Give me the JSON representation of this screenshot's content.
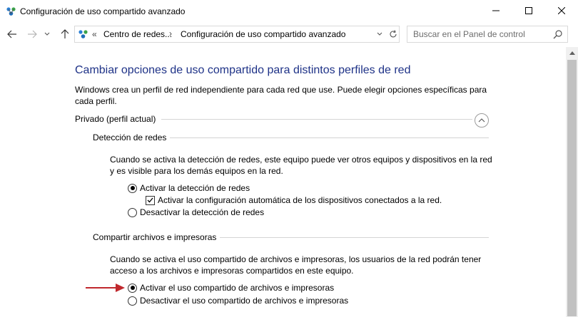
{
  "window": {
    "title": "Configuración de uso compartido avanzado",
    "minimize_glyph": "—",
    "maximize_glyph": "☐",
    "close_glyph": "✕"
  },
  "nav": {
    "back_icon": "arrow-left-icon",
    "forward_icon": "arrow-right-icon",
    "recent_icon": "chevron-down-icon",
    "up_icon": "arrow-up-icon"
  },
  "address": {
    "overflow": "«",
    "crumb1": "Centro de redes...",
    "separator": "›",
    "crumb2": "Configuración de uso compartido avanzado"
  },
  "search": {
    "placeholder": "Buscar en el Panel de control"
  },
  "content": {
    "heading": "Cambiar opciones de uso compartido para distintos perfiles de red",
    "description": "Windows crea un perfil de red independiente para cada red que use. Puede elegir opciones específicas para cada perfil.",
    "profile": {
      "label": "Privado (perfil actual)",
      "network_discovery": {
        "title": "Detección de redes",
        "description_line1": "Cuando se activa la detección de redes, este equipo puede ver otros equipos y dispositivos en la red",
        "description_line2": "y es visible para los demás equipos en la red.",
        "option_on": "Activar la detección de redes",
        "option_auto": "Activar la configuración automática de los dispositivos conectados a la red.",
        "option_off": "Desactivar la detección de redes",
        "selected": "on",
        "auto_checked": true
      },
      "file_sharing": {
        "title": "Compartir archivos e impresoras",
        "description_line1": "Cuando se activa el uso compartido de archivos e impresoras, los usuarios de la red podrán tener",
        "description_line2": "acceso a los archivos e impresoras compartidos en este equipo.",
        "option_on": "Activar el uso compartido de archivos e impresoras",
        "option_off": "Desactivar el uso compartido de archivos e impresoras",
        "selected": "on"
      }
    }
  },
  "colors": {
    "heading": "#1e3287",
    "annotation_arrow": "#c0282d",
    "rule": "#d4d4d4"
  }
}
